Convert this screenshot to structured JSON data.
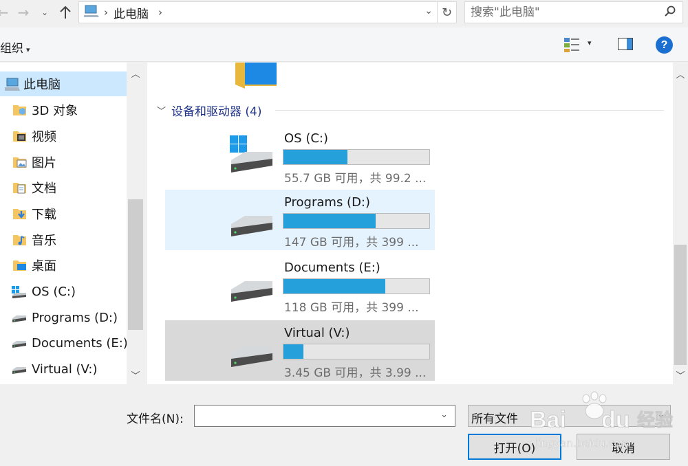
{
  "address_bar": {
    "breadcrumb": "此电脑",
    "search_placeholder": "搜索\"此电脑\""
  },
  "command_bar": {
    "organize_label": "组织"
  },
  "nav_pane": {
    "items": [
      {
        "label": "此电脑",
        "icon": "computer-icon",
        "selected": true
      },
      {
        "label": "3D 对象",
        "icon": "3d-objects-folder-icon"
      },
      {
        "label": "视频",
        "icon": "videos-folder-icon"
      },
      {
        "label": "图片",
        "icon": "pictures-folder-icon"
      },
      {
        "label": "文档",
        "icon": "documents-folder-icon"
      },
      {
        "label": "下载",
        "icon": "downloads-folder-icon"
      },
      {
        "label": "音乐",
        "icon": "music-folder-icon"
      },
      {
        "label": "桌面",
        "icon": "desktop-folder-icon"
      },
      {
        "label": "OS (C:)",
        "icon": "windows-drive-icon"
      },
      {
        "label": "Programs (D:)",
        "icon": "drive-icon"
      },
      {
        "label": "Documents (E:)",
        "icon": "drive-icon"
      },
      {
        "label": "Virtual (V:)",
        "icon": "drive-icon"
      }
    ]
  },
  "content": {
    "group_header": "设备和驱动器 (4)",
    "drives": [
      {
        "name": "OS (C:)",
        "free_text": "55.7 GB 可用，共 99.2 ...",
        "used_fraction": 0.44,
        "state": "normal",
        "icon": "windows-drive-icon"
      },
      {
        "name": "Programs (D:)",
        "free_text": "147 GB 可用，共 399 ...",
        "used_fraction": 0.63,
        "state": "hover",
        "icon": "drive-icon"
      },
      {
        "name": "Documents (E:)",
        "free_text": "118 GB 可用，共 399 ...",
        "used_fraction": 0.7,
        "state": "normal",
        "icon": "drive-icon"
      },
      {
        "name": "Virtual (V:)",
        "free_text": "3.45 GB 可用，共 3.99 ...",
        "used_fraction": 0.135,
        "state": "selected",
        "icon": "drive-icon"
      }
    ]
  },
  "footer": {
    "filename_label": "文件名(N):",
    "filename_value": "",
    "filter_value": "所有文件",
    "open_label": "打开(O)",
    "cancel_label": "取消"
  },
  "watermark_text": "Baidu经验 jingyan.baidu.com",
  "colors": {
    "selection": "#cce8ff",
    "hover": "#e5f3ff",
    "selected_gray": "#d9d9d9",
    "bar_fill": "#26a0da",
    "group_header": "#1e3287",
    "accent": "#0078d7"
  }
}
